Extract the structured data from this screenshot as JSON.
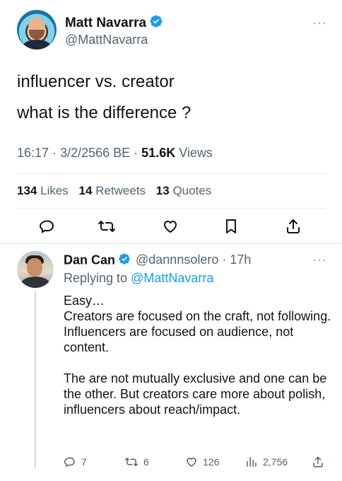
{
  "main_tweet": {
    "author_name": "Matt Navarra",
    "author_handle": "@MattNavarra",
    "more_label": "···",
    "text_line1": "influencer vs. creator",
    "text_line2": "what is the difference ?",
    "time": "16:17",
    "date": "3/2/2566 BE",
    "views_count": "51.6K",
    "views_label": "Views",
    "likes_count": "134",
    "likes_label": "Likes",
    "retweets_count": "14",
    "retweets_label": "Retweets",
    "quotes_count": "13",
    "quotes_label": "Quotes"
  },
  "reply": {
    "author_name": "Dan Can",
    "author_handle": "@dannnsolero",
    "time_ago": "17h",
    "more_label": "···",
    "replying_to_label": "Replying to",
    "replying_to_handle": "@MattNavarra",
    "body": "Easy…\nCreators are focused on the craft, not following.\nInfluencers are focused on audience, not content.\n\nThe are not mutually exclusive and one can be the other. But creators care more about polish, influencers about reach/impact.",
    "reply_count": "7",
    "retweet_count": "6",
    "like_count": "126",
    "view_count": "2,756"
  },
  "colors": {
    "accent": "#1d9bf0",
    "text": "#0f1419",
    "muted": "#536471",
    "divider": "#e6ecf0"
  },
  "icons": [
    "verified-badge-icon",
    "reply-icon",
    "retweet-icon",
    "like-icon",
    "bookmark-icon",
    "share-icon",
    "views-icon",
    "more-icon"
  ]
}
